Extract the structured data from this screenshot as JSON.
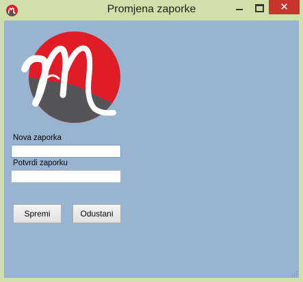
{
  "window": {
    "title": "Promjena zaporke",
    "controls": {
      "minimize": "minimize",
      "maximize": "maximize",
      "close_glyph": "✕"
    }
  },
  "logo": {
    "letter": "M",
    "colors": {
      "red": "#e01c26",
      "gray": "#555558",
      "white": "#ffffff"
    }
  },
  "form": {
    "new_password_label": "Nova zaporka",
    "new_password_value": "",
    "confirm_password_label": "Potvrdi zaporku",
    "confirm_password_value": ""
  },
  "buttons": {
    "save": "Spremi",
    "cancel": "Odustani"
  },
  "colors": {
    "titlebar": "#d1e0a9",
    "client": "#99b4d1",
    "close": "#c7352c"
  }
}
